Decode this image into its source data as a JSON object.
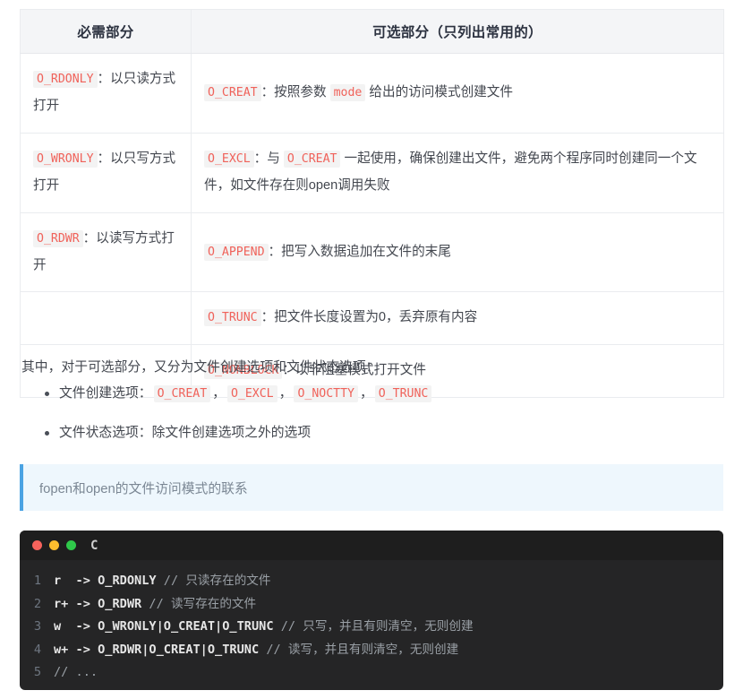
{
  "table": {
    "headers": [
      "必需部分",
      "可选部分（只列出常用的）"
    ],
    "rows": [
      {
        "required_code": "O_RDONLY",
        "required_text": "：以只读方式打开",
        "optional_code": "O_CREAT",
        "optional_text_1": "：按照参数 ",
        "optional_code_2": "mode",
        "optional_text_2": " 给出的访问模式创建文件"
      },
      {
        "required_code": "O_WRONLY",
        "required_text": "：以只写方式打开",
        "optional_code": "O_EXCL",
        "optional_text_1": "：与 ",
        "optional_code_2": "O_CREAT",
        "optional_text_2": " 一起使用，确保创建出文件，避免两个程序同时创建同一个文件，如文件存在则open调用失败"
      },
      {
        "required_code": "O_RDWR",
        "required_text": "：以读写方式打开",
        "optional_code": "O_APPEND",
        "optional_text_1": "：把写入数据追加在文件的末尾"
      },
      {
        "required_code": "",
        "required_text": "",
        "optional_code": "O_TRUNC",
        "optional_text_1": "：把文件长度设置为0，丢弃原有内容"
      },
      {
        "required_code": "",
        "required_text": "",
        "optional_code": "O_NONBLOCK",
        "optional_text_1": "：以非阻塞模式打开文件"
      }
    ]
  },
  "paragraph": "其中，对于可选部分，又分为文件创建选项和文件状态选项：",
  "bullets": [
    {
      "label": "文件创建选项：",
      "codes": [
        "O_CREAT",
        "O_EXCL",
        "O_NOCTTY",
        "O_TRUNC"
      ],
      "separator": "，"
    },
    {
      "label": "文件状态选项：除文件创建选项之外的选项",
      "codes": [],
      "separator": ""
    }
  ],
  "blockquote": "fopen和open的文件访问模式的联系",
  "code_block": {
    "language": "C",
    "window_dots": [
      "red-dot",
      "yellow-dot",
      "green-dot"
    ],
    "lines": [
      {
        "number": "1",
        "code": "r  -> O_RDONLY ",
        "comment": "// 只读存在的文件"
      },
      {
        "number": "2",
        "code": "r+ -> O_RDWR ",
        "comment": "// 读写存在的文件"
      },
      {
        "number": "3",
        "code": "w  -> O_WRONLY|O_CREAT|O_TRUNC ",
        "comment": "// 只写，并且有则清空，无则创建"
      },
      {
        "number": "4",
        "code": "w+ -> O_RDWR|O_CREAT|O_TRUNC ",
        "comment": "// 读写，并且有则清空，无则创建"
      },
      {
        "number": "5",
        "code": "",
        "comment": "// ..."
      }
    ]
  },
  "colors": {
    "inline_code_text": "#f0625a",
    "inline_code_bg": "#f3f3f3",
    "table_header_bg": "#f4f5f7",
    "table_border": "#eaecef",
    "quote_bg": "#eef7fd",
    "quote_border": "#4ba3e3",
    "code_bg": "#252526",
    "code_titlebar_bg": "#1e1e1e",
    "dot_red": "#f7635c",
    "dot_yellow": "#fbbd2e",
    "dot_green": "#2fc84a"
  }
}
